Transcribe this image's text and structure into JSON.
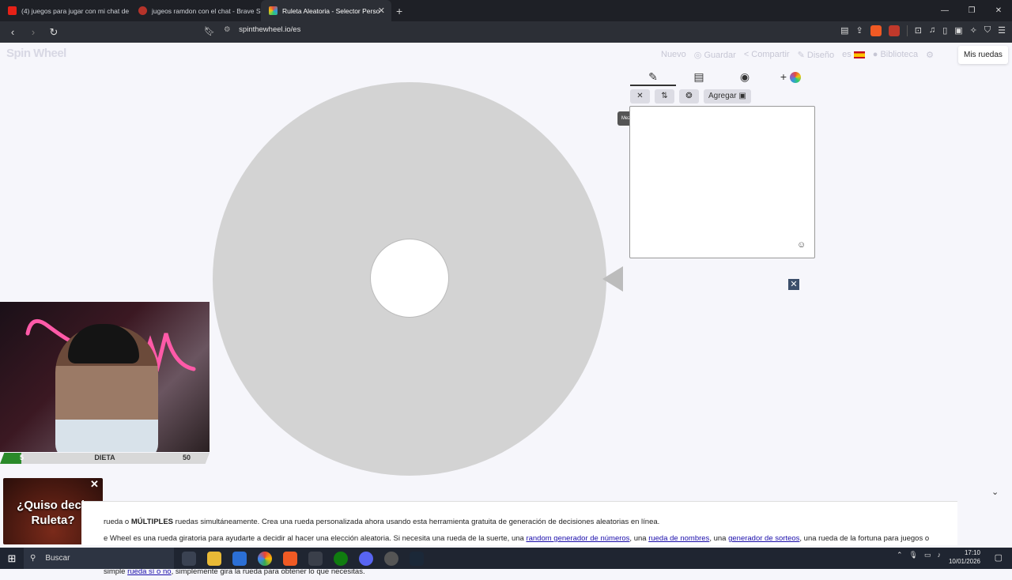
{
  "browser": {
    "tabs": [
      {
        "label": "(4) juegos para jugar con mi chat de",
        "color": "#e62117"
      },
      {
        "label": "jugeos ramdon con el chat - Brave Se",
        "color": "#b5332a"
      },
      {
        "label": "Ruleta Aleatoria - Selector Perso",
        "color": "#6a5acd"
      }
    ],
    "new_tab": "+",
    "url": "spinthewheel.io/es"
  },
  "site": {
    "logo": "Spin Wheel",
    "nav": {
      "nuevo": "Nuevo",
      "guardar": "Guardar",
      "compartir": "Compartir",
      "diseno": "Diseño",
      "lang": "es",
      "biblioteca": "Biblioteca"
    },
    "mis_ruedas": "Mis ruedas"
  },
  "panel": {
    "add_button": "Agregar",
    "tooltip": "Mezclar entradas",
    "entries_value": ""
  },
  "stream_overlay": {
    "diet_low": "5",
    "diet_label": "DIETA",
    "diet_high": "50",
    "diet_progress": 0.1,
    "promo_text_1": "¿Quiso decir",
    "promo_text_2": "Ruleta?"
  },
  "description": {
    "line1_a": "rueda o ",
    "line1_bold": "MÚLTIPLES",
    "line1_b": " ruedas simultáneamente. Crea una rueda personalizada ahora usando esta herramienta gratuita de generación de decisiones aleatorias en línea.",
    "line2_a": "e Wheel es una rueda giratoria para ayudarte a decidir al hacer una elección aleatoria. Si necesita una rueda de la suerte, una ",
    "link1": "random generador de números",
    "line2_b": ", una ",
    "link2": "rueda de nombres",
    "line2_c": ", una ",
    "link3": "generador de sorteos",
    "line2_d": ", una rueda de la fortuna para juegos o una",
    "line3_a": "simple ",
    "link4": "rueda sí o no",
    "line3_b": ", simplemente gira la rueda para obtener lo que necesitas."
  },
  "taskbar": {
    "search_label": "Buscar",
    "time": "17:10",
    "date": "10/01/2026"
  }
}
